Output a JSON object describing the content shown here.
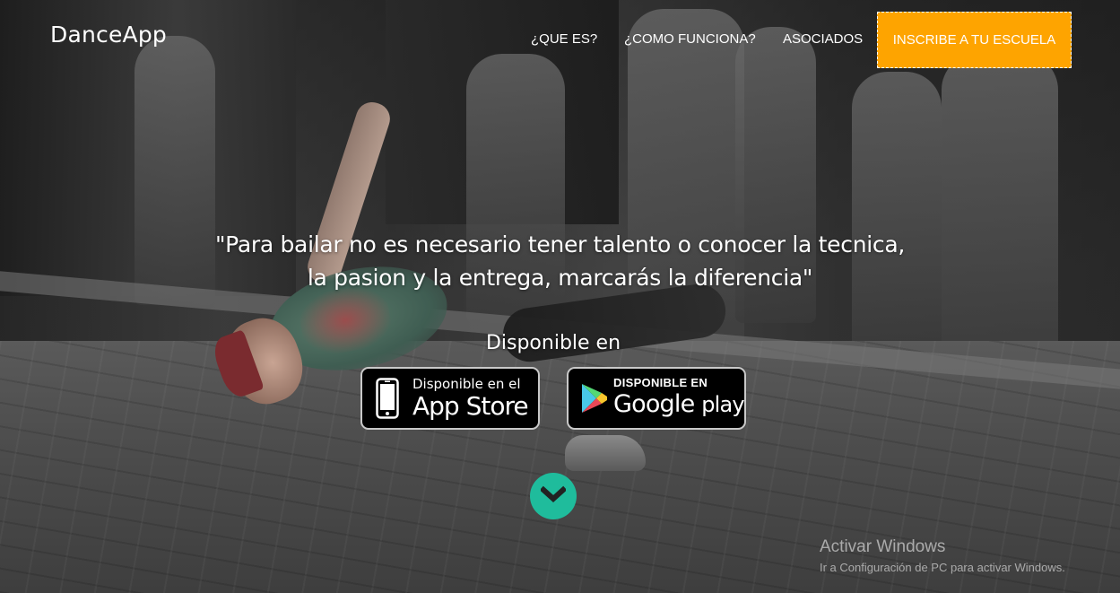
{
  "brand": "DanceApp",
  "nav": {
    "items": [
      {
        "label": "¿QUE ES?"
      },
      {
        "label": "¿COMO FUNCIONA?"
      },
      {
        "label": "ASOCIADOS"
      }
    ],
    "cta_label": "INSCRIBE A TU ESCUELA",
    "cta_color": "#fea400"
  },
  "hero": {
    "quote_line1": "\"Para bailar no es necesario tener talento o conocer la tecnica,",
    "quote_line2": "la pasion y la entrega, marcarás la diferencia\"",
    "available_label": "Disponible en",
    "appstore": {
      "small": "Disponible en el",
      "big": "App Store"
    },
    "googleplay": {
      "small": "DISPONIBLE EN",
      "big_google": "Google",
      "big_play": "play"
    },
    "scroll_icon": "chevron-down-icon",
    "scroll_color": "#1fbc9c"
  },
  "watermark": {
    "title": "Activar Windows",
    "subtitle": "Ir a Configuración de PC para activar Windows."
  }
}
